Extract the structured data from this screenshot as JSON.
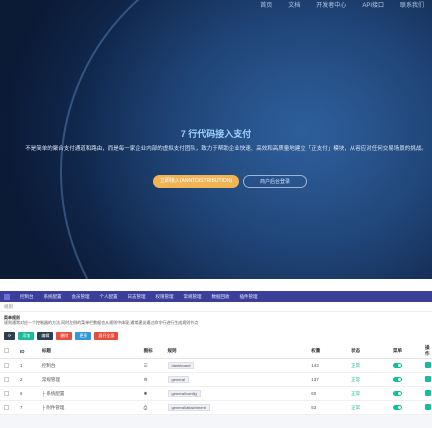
{
  "hero": {
    "nav": [
      "首页",
      "文档",
      "开发者中心",
      "API接口",
      "联系我们"
    ],
    "title": "7 行代码接入支付",
    "description": "不是简单的聚合支付通道和路由，而是每一家企业内部的虚拟支付团队，致力于帮助企业快速、高效和高质量地建立「正支付」模块，从容应对任何交易场景的挑战。",
    "primary_button": "立即接入(ANNTDISTRIBUTION)",
    "secondary_button": "商户后台登录"
  },
  "admin": {
    "menu": [
      "控制台",
      "系统配置",
      "会员管理",
      "个人配置",
      "日志管理",
      "权限管理",
      "常规管理",
      "数据回收",
      "插件管理"
    ],
    "breadcrumb": "规则",
    "panel_title": "菜单规则",
    "panel_desc": "规则通常对应一个控制器的方法,同时左侧的菜单栏数据也从规则中体现,通常建议通过命令行进行生成规则节点",
    "toolbar": [
      {
        "label": "添加",
        "color": "#18bc9c"
      },
      {
        "label": "编辑",
        "color": "#2c3e50"
      },
      {
        "label": "删除",
        "color": "#e74c3c"
      },
      {
        "label": "更多",
        "color": "#3498db"
      },
      {
        "label": "展开全部",
        "color": "#e74c3c"
      }
    ],
    "columns": [
      "ID",
      "标题",
      "图标",
      "规则",
      "权重",
      "状态",
      "菜单",
      "操作"
    ],
    "rows": [
      {
        "id": "1",
        "title": "控制台",
        "rule": "dashboard",
        "weight": "143",
        "status": "正常"
      },
      {
        "id": "2",
        "title": "常规管理",
        "rule": "general",
        "weight": "137",
        "status": "正常"
      },
      {
        "id": "6",
        "title": "├ 系统配置",
        "rule": "general/config",
        "weight": "60",
        "status": "正常"
      },
      {
        "id": "7",
        "title": "├ 附件管理",
        "rule": "general/attachment",
        "weight": "53",
        "status": "正常"
      }
    ]
  }
}
